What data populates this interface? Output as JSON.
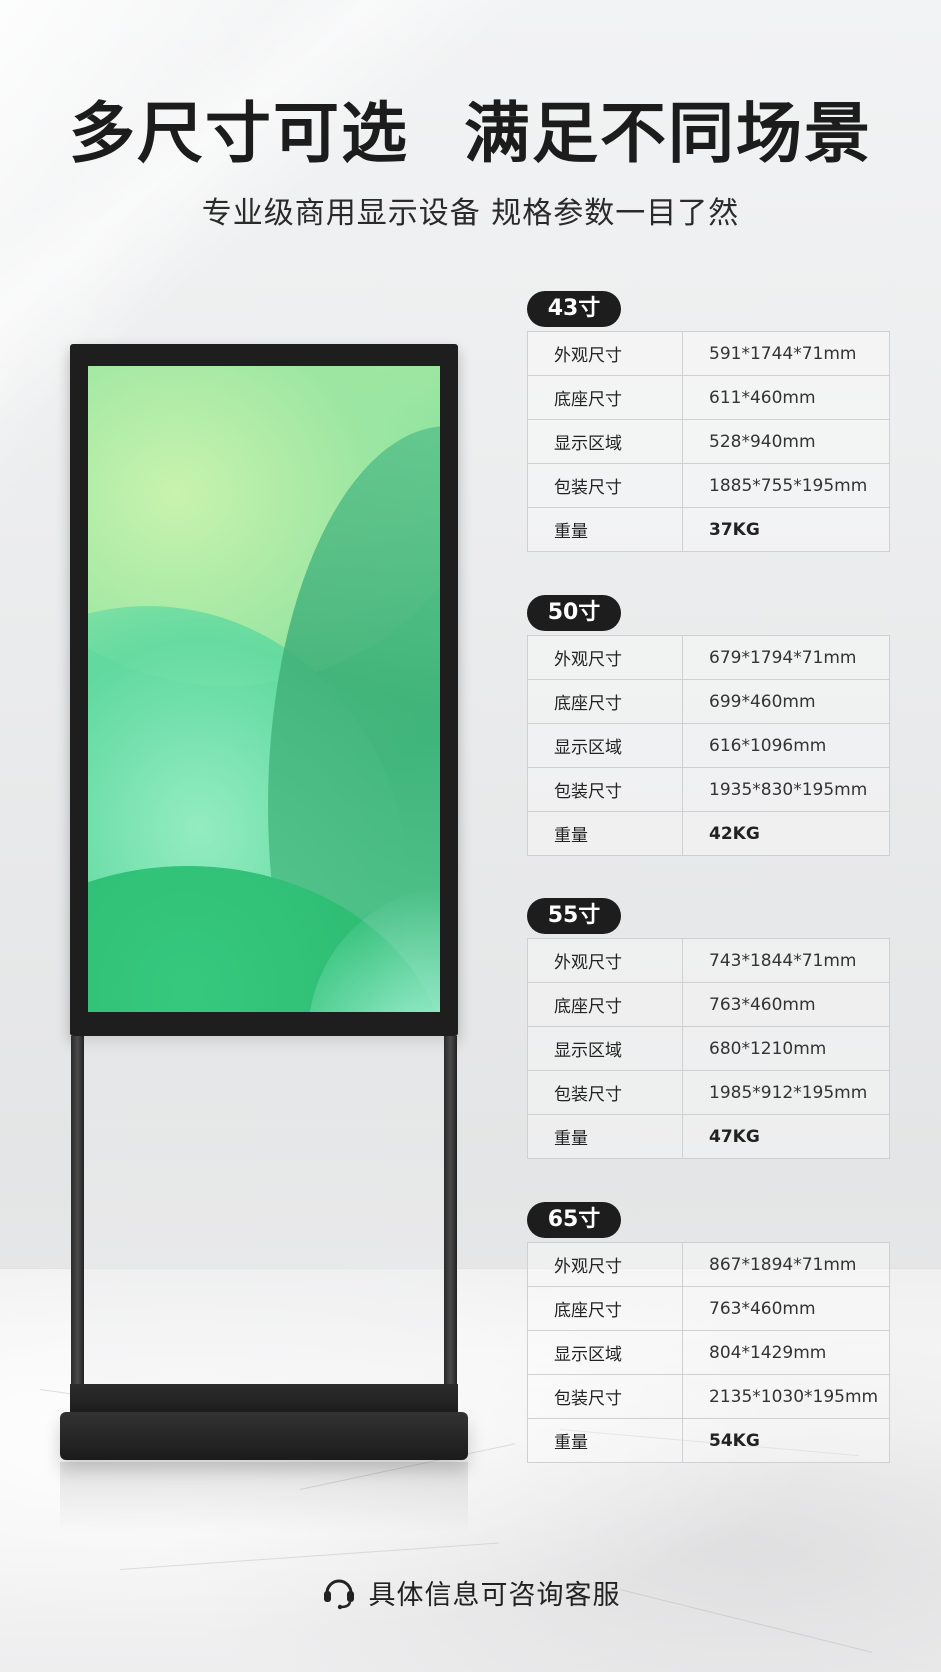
{
  "header": {
    "title": "多尺寸可选 满足不同场景",
    "subtitle": "专业级商用显示设备 规格参数一目了然"
  },
  "specs": [
    {
      "size": "43寸",
      "rows": [
        {
          "label": "外观尺寸",
          "value": "591*1744*71mm"
        },
        {
          "label": "底座尺寸",
          "value": "611*460mm"
        },
        {
          "label": "显示区域",
          "value": "528*940mm"
        },
        {
          "label": "包装尺寸",
          "value": "1885*755*195mm"
        },
        {
          "label": "重量",
          "value": "37KG"
        }
      ]
    },
    {
      "size": "50寸",
      "rows": [
        {
          "label": "外观尺寸",
          "value": "679*1794*71mm"
        },
        {
          "label": "底座尺寸",
          "value": "699*460mm"
        },
        {
          "label": "显示区域",
          "value": "616*1096mm"
        },
        {
          "label": "包装尺寸",
          "value": "1935*830*195mm"
        },
        {
          "label": "重量",
          "value": "42KG"
        }
      ]
    },
    {
      "size": "55寸",
      "rows": [
        {
          "label": "外观尺寸",
          "value": "743*1844*71mm"
        },
        {
          "label": "底座尺寸",
          "value": "763*460mm"
        },
        {
          "label": "显示区域",
          "value": "680*1210mm"
        },
        {
          "label": "包装尺寸",
          "value": "1985*912*195mm"
        },
        {
          "label": "重量",
          "value": "47KG"
        }
      ]
    },
    {
      "size": "65寸",
      "rows": [
        {
          "label": "外观尺寸",
          "value": "867*1894*71mm"
        },
        {
          "label": "底座尺寸",
          "value": "763*460mm"
        },
        {
          "label": "显示区域",
          "value": "804*1429mm"
        },
        {
          "label": "包装尺寸",
          "value": "2135*1030*195mm"
        },
        {
          "label": "重量",
          "value": "54KG"
        }
      ]
    }
  ],
  "footer": {
    "icon": "headset-icon",
    "text": "具体信息可咨询客服"
  },
  "colors": {
    "badge": "#1d1d1d",
    "frame": "#1e1e1e",
    "screen_green": "#3fc983"
  }
}
